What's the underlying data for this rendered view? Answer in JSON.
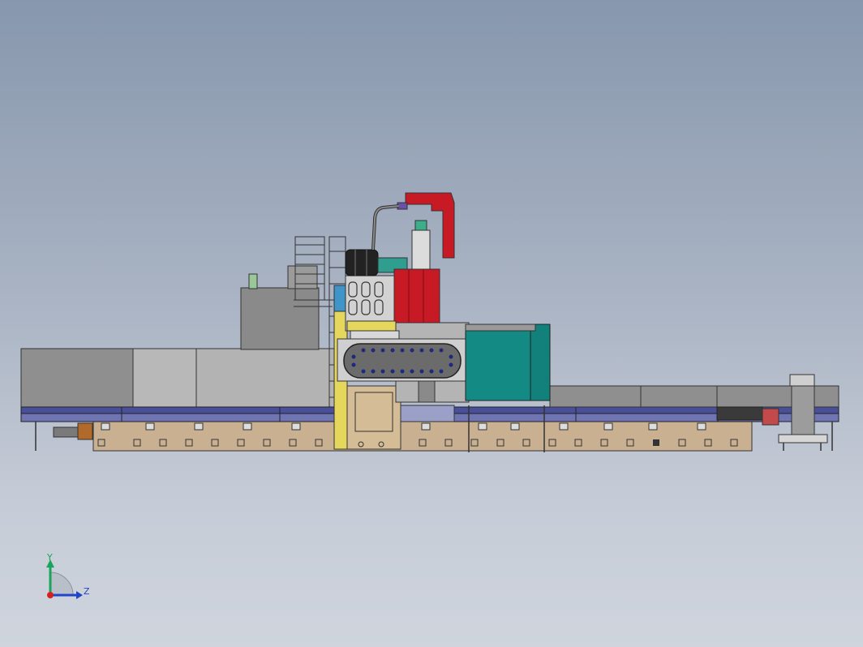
{
  "viewport": {
    "background_top": "#8797ad",
    "background_bottom": "#cfd4dd"
  },
  "triad": {
    "y_label": "Y",
    "z_label": "Z",
    "y_color": "#1aa35a",
    "z_color": "#1f45c8",
    "x_color": "#d42020"
  },
  "model_colors": {
    "base": "#c9b091",
    "rail": "#4a4f9a",
    "guard": "#8e8e8e",
    "guard_light": "#b5b5b5",
    "teal": "#138a84",
    "red": "#c81a24",
    "yellow": "#e5d65c",
    "column": "#d4bc96"
  }
}
